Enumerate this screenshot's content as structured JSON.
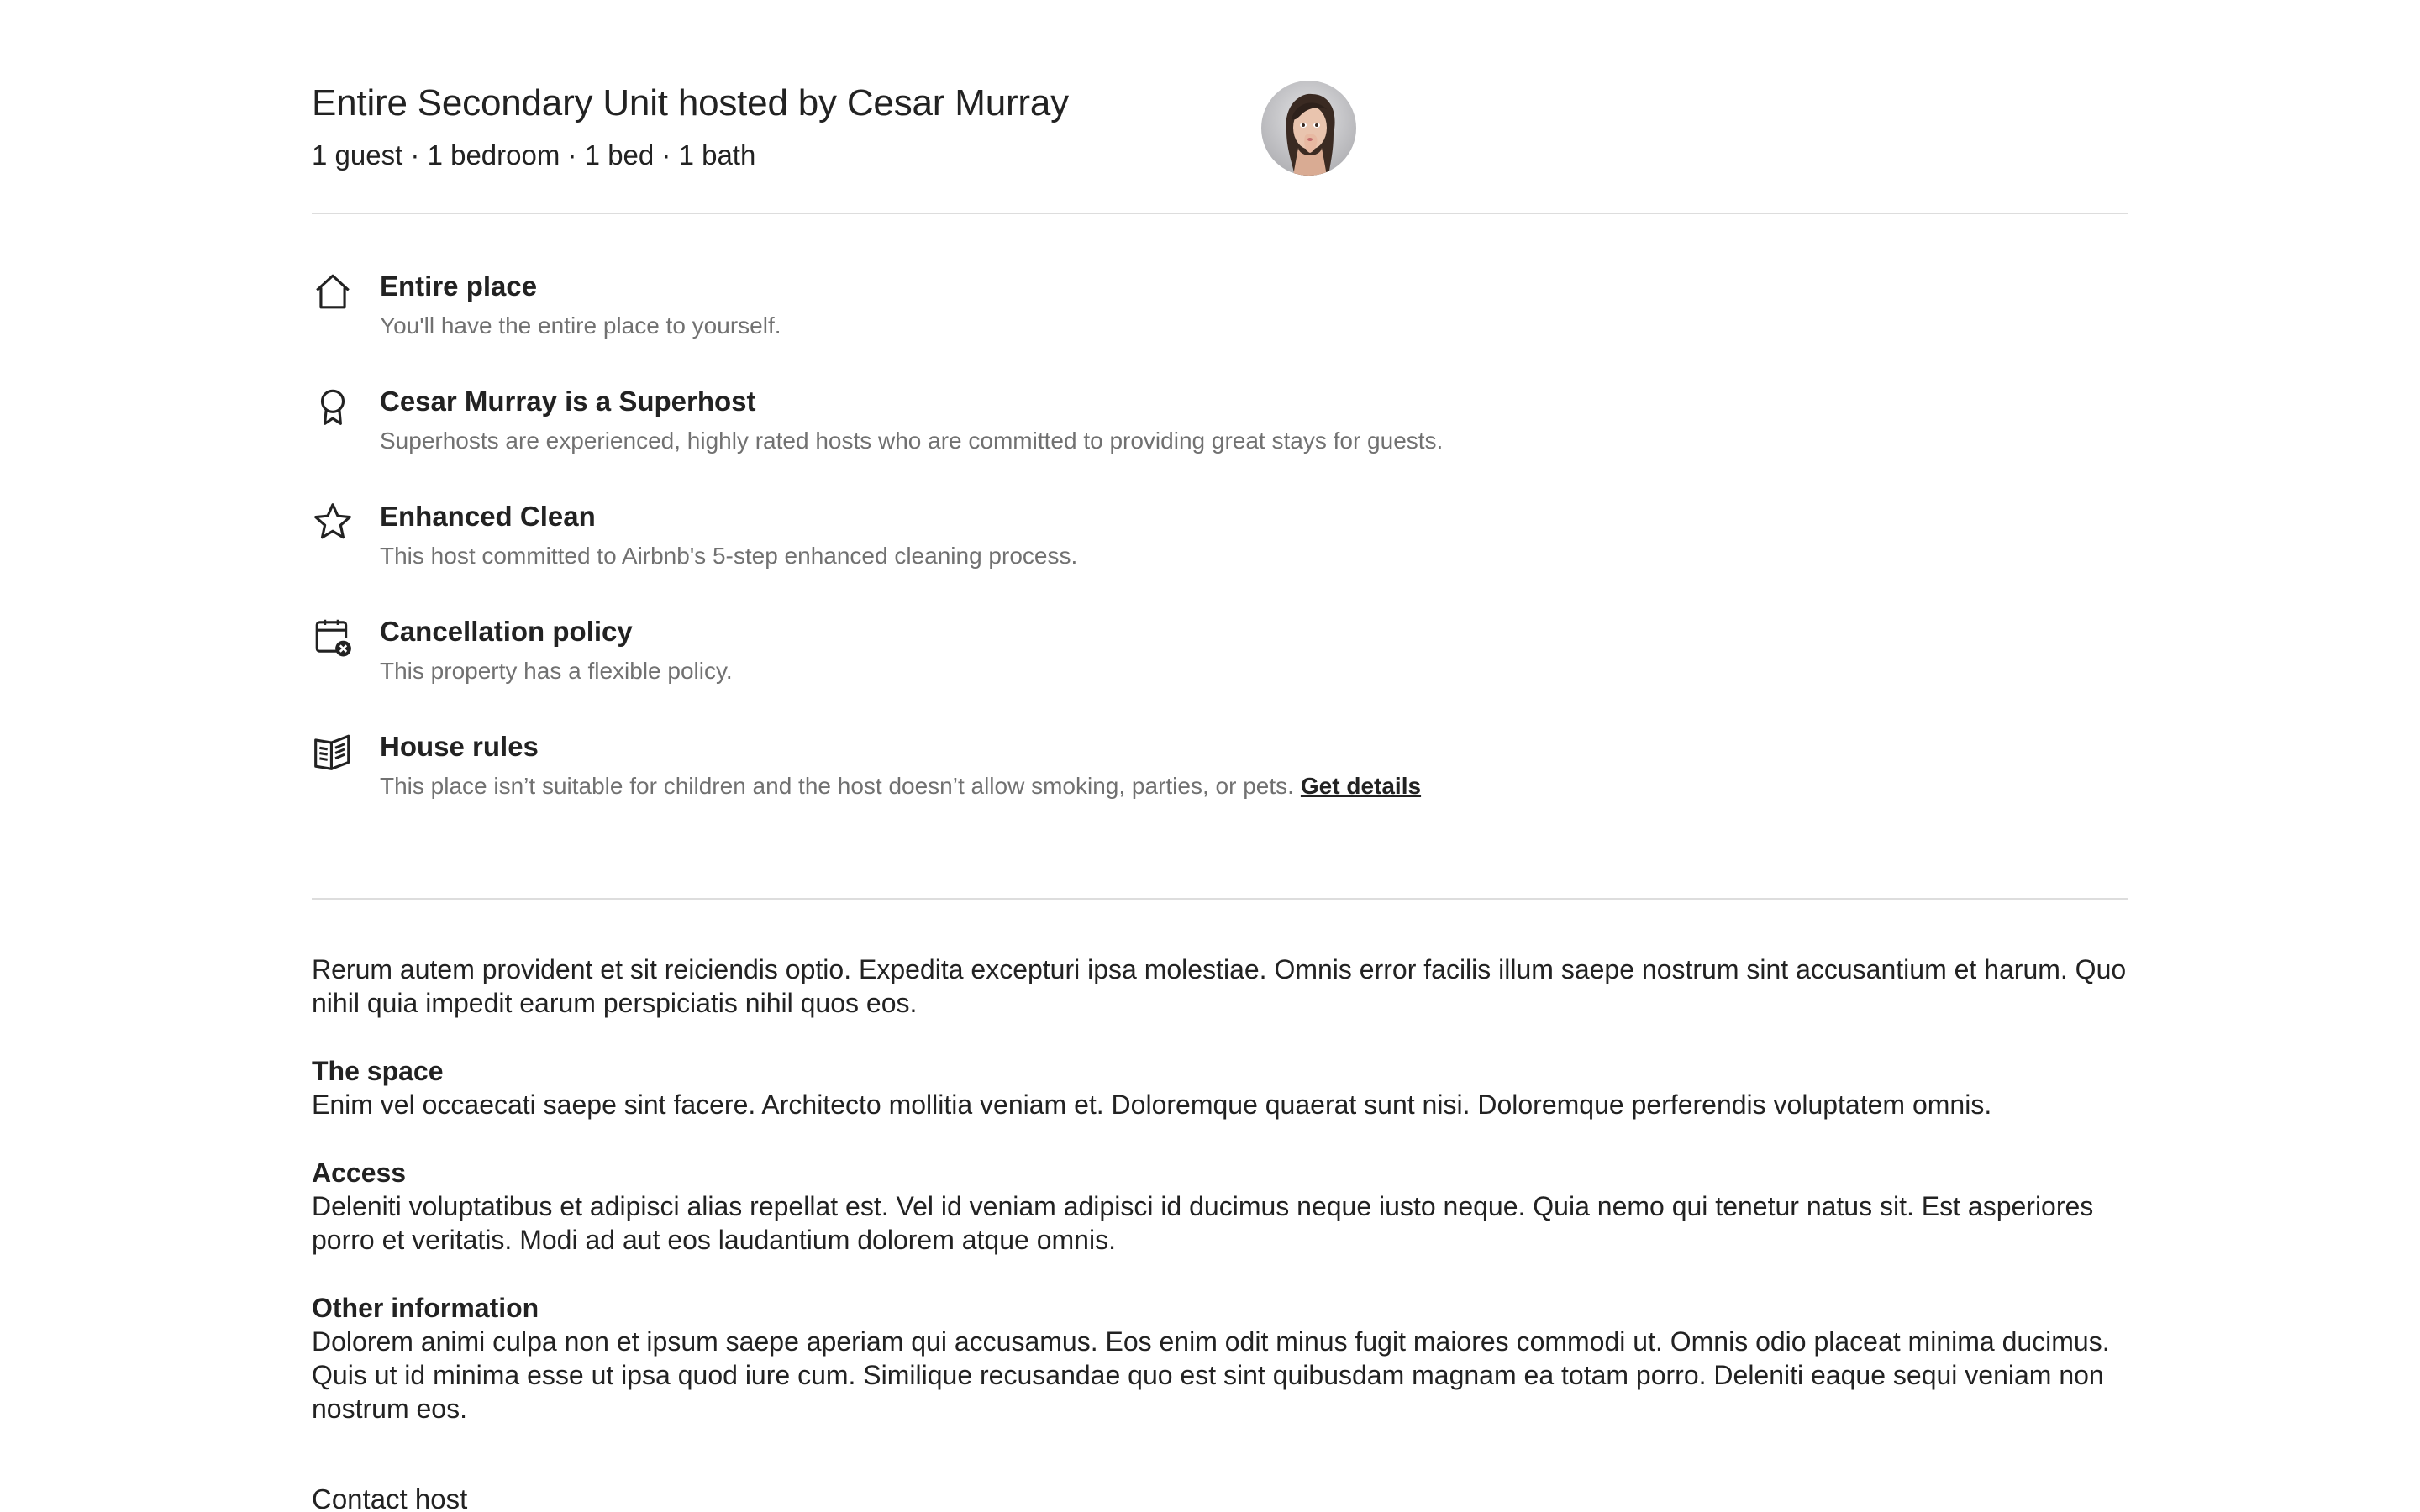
{
  "listing": {
    "title": "Entire Secondary Unit hosted by Cesar Murray",
    "summary": "1 guest · 1 bedroom · 1 bed · 1 bath"
  },
  "highlights": [
    {
      "icon": "home-icon",
      "title": "Entire place",
      "description": "You'll have the entire place to yourself."
    },
    {
      "icon": "superhost-badge-icon",
      "title": "Cesar Murray is a Superhost",
      "description": "Superhosts are experienced, highly rated hosts who are committed to providing great stays for guests."
    },
    {
      "icon": "star-icon",
      "title": "Enhanced Clean",
      "description": "This host committed to Airbnb's 5-step enhanced cleaning process."
    },
    {
      "icon": "calendar-cancel-icon",
      "title": "Cancellation policy",
      "description": "This property has a flexible policy."
    },
    {
      "icon": "rules-book-icon",
      "title": "House rules",
      "description": "This place isn’t suitable for children and the host doesn’t allow smoking, parties, or pets.",
      "link": "Get details"
    }
  ],
  "description": {
    "intro": "Rerum autem provident et sit reiciendis optio. Expedita excepturi ipsa molestiae. Omnis error facilis illum saepe nostrum sint accusantium et harum. Quo nihil quia impedit earum perspiciatis nihil quos eos.",
    "space_heading": "The space",
    "space_text": "Enim vel occaecati saepe sint facere. Architecto mollitia veniam et. Doloremque quaerat sunt nisi. Doloremque perferendis voluptatem omnis.",
    "access_heading": "Access",
    "access_text": "Deleniti voluptatibus et adipisci alias repellat est. Vel id veniam adipisci id ducimus neque iusto neque. Quia nemo qui tenetur natus sit. Est asperiores porro et veritatis. Modi ad aut eos laudantium dolorem atque omnis.",
    "other_heading": "Other information",
    "other_text": "Dolorem animi culpa non et ipsum saepe aperiam qui accusamus. Eos enim odit minus fugit maiores commodi ut. Omnis odio placeat minima ducimus. Quis ut id minima esse ut ipsa quod iure cum. Similique recusandae quo est sint quibusdam magnam ea totam porro. Deleniti eaque sequi veniam non nostrum eos."
  },
  "contact_label": "Contact host"
}
